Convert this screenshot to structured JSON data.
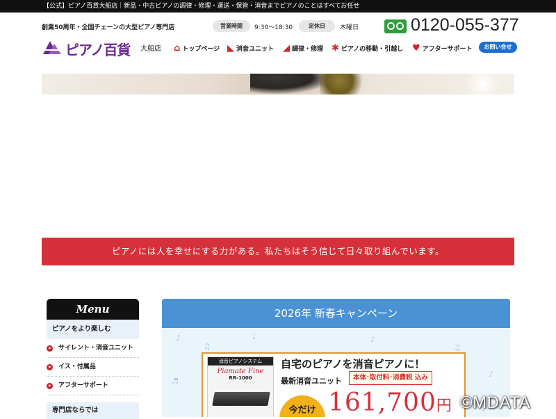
{
  "topbar": {
    "text": "【公式】ピアノ百貨大船店｜新品・中古ピアノの調律・修理・運送・保管・消音までピアノのことはすべてお任せ"
  },
  "header": {
    "tagline": "創業50周年・全国チェーンの大型ピアノ専門店",
    "hours_label": "営業時間",
    "hours_value": "9:30〜18:30",
    "closed_label": "定休日",
    "closed_value": "木曜日",
    "phone": "0120-055-377",
    "logo_text": "ピアノ百貨",
    "branch": "大船店"
  },
  "nav": {
    "home": "トップページ",
    "silent": "消音ユニット",
    "tune": "調律・修理",
    "move": "ピアノの移動・引越し",
    "after": "アフターサポート",
    "contact": "お問い合せ"
  },
  "mission": "ピアノには人を幸せにする力がある。私たちはそう信じて日々取り組んでいます。",
  "sidebar": {
    "menu_title": "Menu",
    "section1": "ピアノをより楽しむ",
    "items": [
      "サイレント・消音ユニット",
      "イス・付属品",
      "アフターサポート"
    ],
    "section2": "専門店ならでは"
  },
  "campaign": {
    "title": "2026年 新春キャンペーン",
    "product_category": "消音ピアノシステム",
    "product_name": "Piamate Fine",
    "product_model": "RR-1000",
    "headline": "自宅のピアノを消音ピアノに！",
    "subline": "最新消音ユニット",
    "tax_note": "本体･取付料･消費税 込み",
    "only_label": "今だけ",
    "price": "161,700",
    "price_unit": "円"
  },
  "watermark": "©MDATA"
}
